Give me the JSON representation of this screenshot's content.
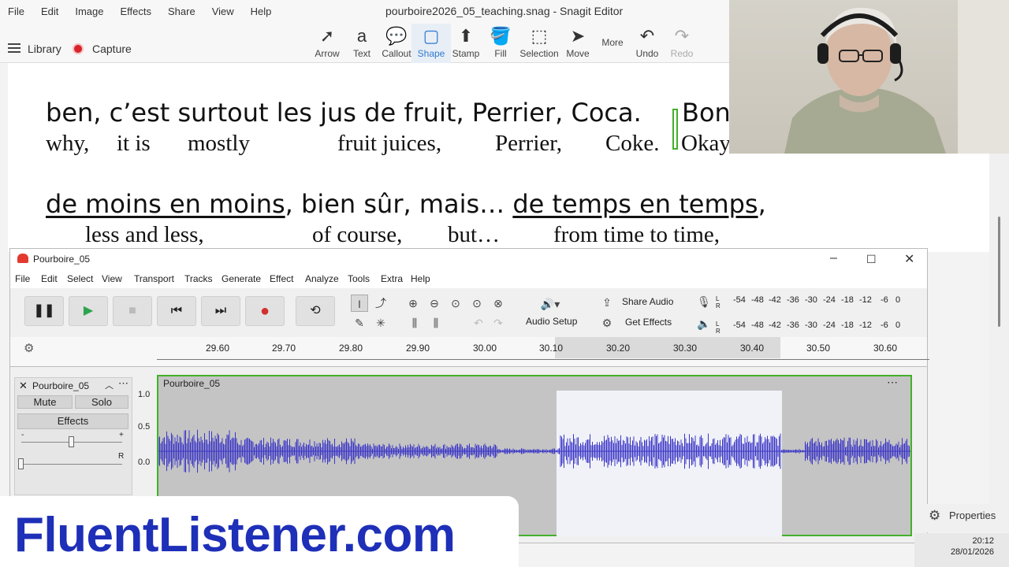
{
  "snagit": {
    "menu": [
      "File",
      "Edit",
      "Image",
      "Effects",
      "Share",
      "View",
      "Help"
    ],
    "title": "pourboire2026_05_teaching.snag - Snagit Editor",
    "library_label": "Library",
    "capture_label": "Capture",
    "tools": [
      {
        "label": "Arrow",
        "icon": "➚"
      },
      {
        "label": "Text",
        "icon": "a"
      },
      {
        "label": "Callout",
        "icon": "💬"
      },
      {
        "label": "Shape",
        "icon": "▢"
      },
      {
        "label": "Stamp",
        "icon": "⬆"
      },
      {
        "label": "Fill",
        "icon": "🪣"
      },
      {
        "label": "Selection",
        "icon": "⬚"
      },
      {
        "label": "Move",
        "icon": "➤"
      },
      {
        "label": "More",
        "icon": ""
      },
      {
        "label": "Undo",
        "icon": "↶"
      },
      {
        "label": "Redo",
        "icon": "↷"
      }
    ],
    "active_tool": "Shape",
    "disabled_tool": "Redo"
  },
  "lesson": {
    "line1_fr": "ben, c’est surtout les jus de fruit, Perrier, Coca.",
    "line1_fr_tail": "Bon",
    "line1_en": [
      "why,",
      "it is",
      "mostly",
      "fruit juices,",
      "Perrier,",
      "Coke.",
      "Okay,"
    ],
    "line2_fr": [
      "de moins en moins",
      ", bien sûr, mais… ",
      "de temps en temps",
      ","
    ],
    "line2_en": [
      "less and less,",
      "of course,",
      "but…",
      "from time to time,"
    ]
  },
  "audacity": {
    "title": "Pourboire_05",
    "menu": [
      "File",
      "Edit",
      "Select",
      "View",
      "Transport",
      "Tracks",
      "Generate",
      "Effect",
      "Analyze",
      "Tools",
      "Extra",
      "Help"
    ],
    "audio_setup": "Audio Setup",
    "share_audio": "Share Audio",
    "get_effects": "Get Effects",
    "meter_ticks": [
      "-54",
      "-48",
      "-42",
      "-36",
      "-30",
      "-24",
      "-18",
      "-12",
      "-6",
      "0"
    ],
    "ruler": [
      "29.60",
      "29.70",
      "29.80",
      "29.90",
      "30.00",
      "30.10",
      "30.20",
      "30.30",
      "30.40",
      "30.50",
      "30.60"
    ],
    "track_name": "Pourboire_05",
    "mute": "Mute",
    "solo": "Solo",
    "effects": "Effects",
    "yaxis": [
      "1.0",
      "0.5",
      "0.0"
    ],
    "pan_right": "R",
    "clip_name": "Pourboire_05",
    "selection_start": 30.1,
    "selection_end": 30.44
  },
  "taskbar": {
    "properties": "Properties",
    "time": "20:12",
    "date": "28/01/2026"
  },
  "brand": "FluentListener.com",
  "colors": {
    "accent": "#2f7bd2",
    "waveform": "#3b36c6",
    "record": "#d8232a",
    "brand": "#1e2fb8",
    "track_border": "#43b02a"
  }
}
